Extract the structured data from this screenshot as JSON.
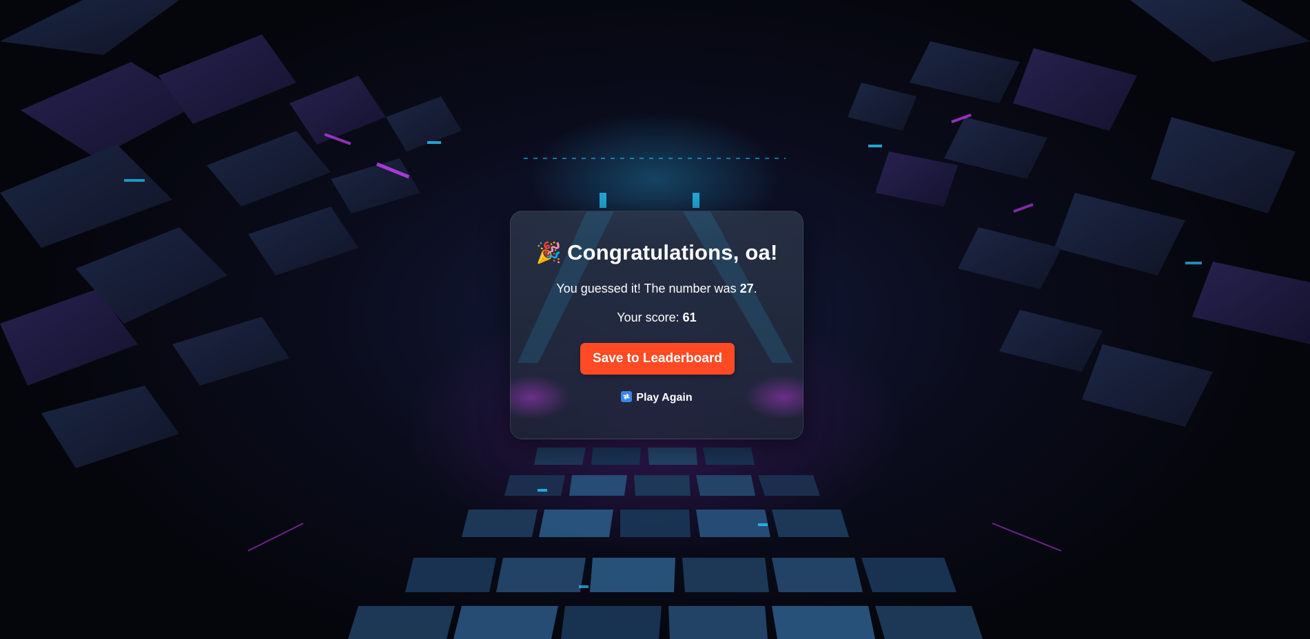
{
  "dialog": {
    "icon": "party-popper-icon",
    "emoji": "🎉",
    "title": "Congratulations, oa!",
    "guess_prefix": "You guessed it! The number was ",
    "number": "27",
    "guess_suffix": ".",
    "score_label": "Your score: ",
    "score": "61",
    "save_button_label": "Save to Leaderboard",
    "play_again_icon": "repeat-icon",
    "play_again_label": "Play Again"
  },
  "colors": {
    "accent": "#ff4a24",
    "card_bg": "#26304a",
    "text": "#ffffff",
    "glow_cyan": "#28c8ff",
    "glow_purple": "#c83ce6"
  }
}
